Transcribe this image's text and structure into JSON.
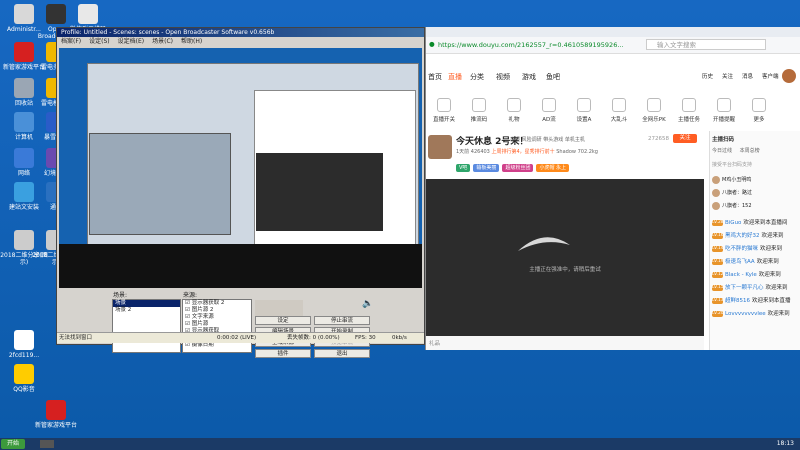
{
  "desktop": {
    "icons": [
      {
        "label": "Administr...",
        "color": "#d8d8d8"
      },
      {
        "label": "Open Broadcaster",
        "color": "#333333"
      },
      {
        "label": "微信群二维码",
        "color": "#e8e8e8"
      },
      {
        "label": "新管家游戏平台",
        "color": "#d62020"
      },
      {
        "label": "雷电多开器",
        "color": "#f0b800"
      },
      {
        "label": "回收站",
        "color": "#9aa6b4"
      },
      {
        "label": "雷电模拟器",
        "color": "#f0b800"
      },
      {
        "label": "计算机",
        "color": "#4a90d8"
      },
      {
        "label": "暴雪游戏",
        "color": "#2a5cc8"
      },
      {
        "label": "网络",
        "color": "#3a7ad8"
      },
      {
        "label": "幻境挑战",
        "color": "#6a4ab0"
      },
      {
        "label": "建站文安装",
        "color": "#3aa0e0"
      },
      {
        "label": "通知",
        "color": "#2a70c0"
      },
      {
        "label": "2018二维分享(图示)",
        "color": "#cccccc"
      },
      {
        "label": "2018二维分享(图示)",
        "color": "#cccccc"
      },
      {
        "label": "2fcd119...",
        "color": "#ffffff"
      },
      {
        "label": "QQ影音",
        "color": "#ffcc00"
      },
      {
        "label": "新管家游戏平台",
        "color": "#d62020"
      }
    ]
  },
  "obs": {
    "title": "Profile: Untitled - Scenes: scenes - Open Broadcaster Software v0.656b",
    "menu": [
      "档案(F)",
      "设定(S)",
      "设定档(E)",
      "场景(C)",
      "帮助(H)"
    ],
    "scenes_label": "场景:",
    "sources_label": "来源:",
    "scenes": [
      "场景",
      "场景 2"
    ],
    "sources": [
      "显示器获取 2",
      "图片源 2",
      "文字来源",
      "图片源",
      "显示器获取",
      "视频",
      "摄像日期"
    ],
    "buttons": {
      "settings": "设定",
      "stop_stream": "停止串流",
      "edit_scene": "编辑场景",
      "start_record": "开始录制",
      "global_source": "全域来源",
      "preview_stream": "预览串流",
      "plugins": "插件",
      "exit": "退出"
    },
    "status": {
      "capture": "无法找到窗口",
      "time": "0:00:02 (LIVE)",
      "dropped": "丢失帧数: 0 (0.00%)",
      "fps": "FPS: 30",
      "bitrate": "0kb/s"
    }
  },
  "browser": {
    "url": "https://www.douyu.com/2162557_r=0.4610589195926...",
    "search_placeholder": "输入文字搜索",
    "nav": [
      "首页",
      "直播",
      "分类",
      "视频",
      "游戏",
      "鱼吧"
    ],
    "header_right": [
      "历史",
      "关注",
      "消息",
      "客户端"
    ],
    "icon_row": [
      "直播开关",
      "推流码",
      "礼物",
      "AD流",
      "设置A",
      "大乱斗",
      "全网乐PK",
      "主播任务",
      "开播提醒",
      "更多"
    ],
    "room_title": "今天休息 2号来！",
    "room_meta": [
      "举报",
      "风险调研",
      "带头游戏",
      "单机主机"
    ],
    "room_badge": "1天前",
    "room_hot": "426403",
    "room_rank": "上周排行第4，星秀排行前十",
    "room_extra": [
      "Shadow",
      "702.2kg"
    ],
    "follow_count": "272658",
    "follow_label": "关注",
    "room_tags": [
      "V吧",
      "输板美丽",
      "超级粉丝团",
      "小虎帽 永上"
    ],
    "video_status": "主播正在强准中，请稍后重试",
    "gift_label": "礼品",
    "chat": {
      "tabs": [
        "主播扫码",
        "今日过线",
        "本周总榜"
      ],
      "notice": "接受平台扫码支持",
      "top_fans": [
        {
          "name": "M鸡小丑明鸣"
        },
        {
          "name": "八旗者：路过"
        },
        {
          "name": "八旗者：152"
        }
      ],
      "messages": [
        {
          "level": "LV.28",
          "user": "BiGuo",
          "text": "欢迎来到本直播间"
        },
        {
          "level": "LV.16",
          "user": "黑鸡大的好32",
          "text": "欢迎来到"
        },
        {
          "level": "LV.14",
          "user": "吃不胖的猫咪",
          "text": "欢迎来到"
        },
        {
          "level": "LV.19",
          "user": "极速鸟飞AA",
          "text": "欢迎来到"
        },
        {
          "level": "LV.12",
          "user": "Black - Kyle",
          "text": "欢迎来到"
        },
        {
          "level": "LV.15",
          "user": "放下一颗平凡心",
          "text": "欢迎来到"
        },
        {
          "level": "LV.13",
          "user": "超鲜8516",
          "text": "欢迎来到本直播"
        },
        {
          "level": "LV.20",
          "user": "Lovvvvvvvvlee",
          "text": "欢迎来到"
        }
      ]
    }
  },
  "taskbar": {
    "start": "开始",
    "clock": "18:13"
  },
  "colors": {
    "accent": "#ff5d23",
    "obs_title": "#0a246a",
    "desktop": "#1768c2"
  }
}
